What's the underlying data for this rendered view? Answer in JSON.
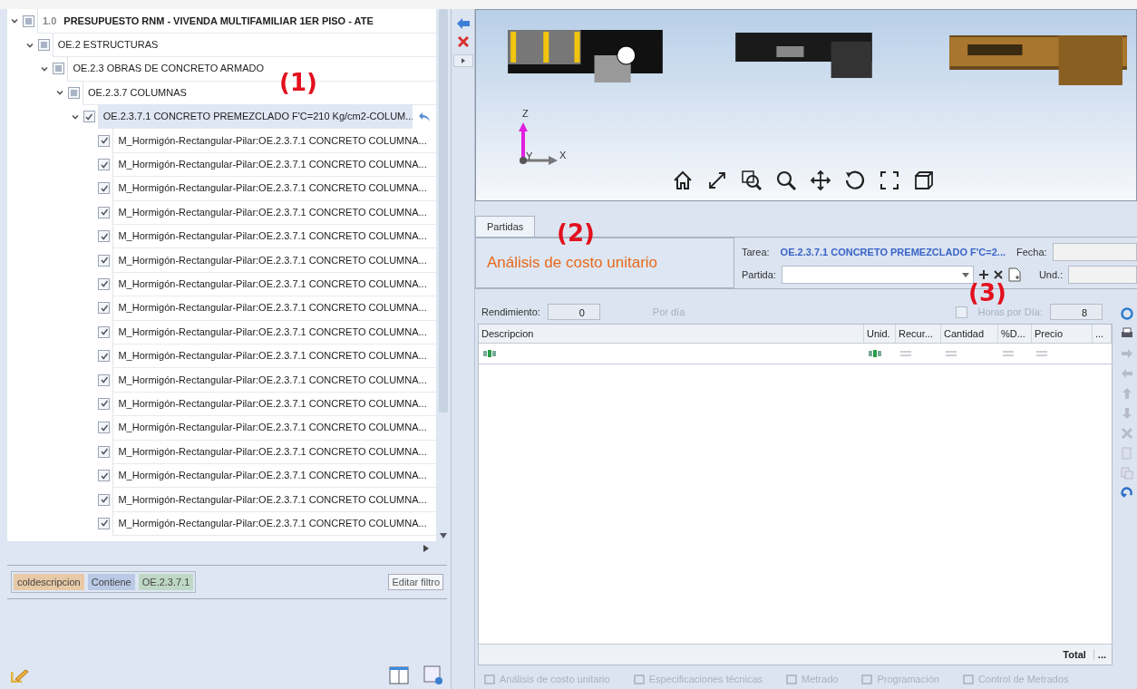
{
  "tree": [
    {
      "code": "1.0",
      "label": "PRESUPUESTO RNM - VIVENDA MULTIFAMILIAR 1ER PISO - ATE",
      "checked": false,
      "indeterminate": true,
      "selected": false,
      "expanded": true,
      "children": [
        {
          "label": "OE.2 ESTRUCTURAS",
          "checked": false,
          "indeterminate": true,
          "selected": false,
          "expanded": true,
          "children": [
            {
              "label": "OE.2.3 OBRAS DE CONCRETO ARMADO",
              "checked": false,
              "indeterminate": true,
              "selected": false,
              "expanded": true,
              "children": [
                {
                  "label": "OE.2.3.7 COLUMNAS",
                  "checked": false,
                  "indeterminate": true,
                  "selected": false,
                  "expanded": true,
                  "children": [
                    {
                      "label": "OE.2.3.7.1 CONCRETO PREMEZCLADO F'C=210 Kg/cm2-COLUM...",
                      "checked": true,
                      "selected": true,
                      "expanded": true,
                      "children": [
                        {
                          "label": "M_Hormigón-Rectangular-Pilar:OE.2.3.7.1 CONCRETO COLUMNA...",
                          "checked": true,
                          "indeterminate": false,
                          "selected": false
                        },
                        {
                          "label": "M_Hormigón-Rectangular-Pilar:OE.2.3.7.1 CONCRETO COLUMNA...",
                          "checked": true,
                          "indeterminate": false,
                          "selected": false
                        },
                        {
                          "label": "M_Hormigón-Rectangular-Pilar:OE.2.3.7.1 CONCRETO COLUMNA...",
                          "checked": true,
                          "indeterminate": false,
                          "selected": false
                        },
                        {
                          "label": "M_Hormigón-Rectangular-Pilar:OE.2.3.7.1 CONCRETO COLUMNA...",
                          "checked": true,
                          "indeterminate": false,
                          "selected": false
                        },
                        {
                          "label": "M_Hormigón-Rectangular-Pilar:OE.2.3.7.1 CONCRETO COLUMNA...",
                          "checked": true,
                          "indeterminate": false,
                          "selected": false
                        },
                        {
                          "label": "M_Hormigón-Rectangular-Pilar:OE.2.3.7.1 CONCRETO COLUMNA...",
                          "checked": true,
                          "indeterminate": false,
                          "selected": false
                        },
                        {
                          "label": "M_Hormigón-Rectangular-Pilar:OE.2.3.7.1 CONCRETO COLUMNA...",
                          "checked": true,
                          "indeterminate": false,
                          "selected": false
                        },
                        {
                          "label": "M_Hormigón-Rectangular-Pilar:OE.2.3.7.1 CONCRETO COLUMNA...",
                          "checked": true,
                          "indeterminate": false,
                          "selected": false
                        },
                        {
                          "label": "M_Hormigón-Rectangular-Pilar:OE.2.3.7.1 CONCRETO COLUMNA...",
                          "checked": true,
                          "indeterminate": false,
                          "selected": false
                        },
                        {
                          "label": "M_Hormigón-Rectangular-Pilar:OE.2.3.7.1 CONCRETO COLUMNA...",
                          "checked": true,
                          "indeterminate": false,
                          "selected": false
                        },
                        {
                          "label": "M_Hormigón-Rectangular-Pilar:OE.2.3.7.1 CONCRETO COLUMNA...",
                          "checked": true,
                          "indeterminate": false,
                          "selected": false
                        },
                        {
                          "label": "M_Hormigón-Rectangular-Pilar:OE.2.3.7.1 CONCRETO COLUMNA...",
                          "checked": true,
                          "indeterminate": false,
                          "selected": false
                        },
                        {
                          "label": "M_Hormigón-Rectangular-Pilar:OE.2.3.7.1 CONCRETO COLUMNA...",
                          "checked": true,
                          "indeterminate": false,
                          "selected": false
                        },
                        {
                          "label": "M_Hormigón-Rectangular-Pilar:OE.2.3.7.1 CONCRETO COLUMNA...",
                          "checked": true,
                          "indeterminate": false,
                          "selected": false
                        },
                        {
                          "label": "M_Hormigón-Rectangular-Pilar:OE.2.3.7.1 CONCRETO COLUMNA...",
                          "checked": true,
                          "indeterminate": false,
                          "selected": false
                        },
                        {
                          "label": "M_Hormigón-Rectangular-Pilar:OE.2.3.7.1 CONCRETO COLUMNA...",
                          "checked": true,
                          "indeterminate": false,
                          "selected": false
                        },
                        {
                          "label": "M_Hormigón-Rectangular-Pilar:OE.2.3.7.1 CONCRETO COLUMNA...",
                          "checked": true,
                          "indeterminate": false,
                          "selected": false
                        }
                      ]
                    }
                  ]
                }
              ]
            }
          ]
        }
      ]
    }
  ],
  "filter": {
    "chips": [
      {
        "text": "coldescripcion",
        "color": "#e8c9a6"
      },
      {
        "text": "Contiene",
        "color": "#b9c9e6"
      },
      {
        "text": "OE.2.3.7.1",
        "color": "#bfd8c6"
      }
    ],
    "edit_button": "Editar filtro"
  },
  "viewer": {
    "kind": "picture",
    "axes": [
      "Z",
      "Y",
      "X"
    ]
  },
  "tabs": [
    {
      "label": "Partidas",
      "selected": true
    }
  ],
  "header": {
    "title": "Análisis de costo unitario",
    "tarea_label": "Tarea:",
    "tarea_value": "OE.2.3.7.1 CONCRETO PREMEZCLADO F'C=2...",
    "fecha_label": "Fecha:",
    "partida_label": "Partida:",
    "und_label": "Und.:"
  },
  "rendimiento": {
    "label": "Rendimiento:",
    "value": "0",
    "unit": "Por día",
    "hours_label": "Horas por Día:",
    "hours_checked": false,
    "hours_value": "8"
  },
  "grid": {
    "columns": [
      {
        "label": "Descripcion",
        "kind": "text"
      },
      {
        "label": "Unid.",
        "kind": "text"
      },
      {
        "label": "Recur...",
        "kind": "number"
      },
      {
        "label": "Cantidad",
        "kind": "number"
      },
      {
        "label": "%D...",
        "kind": "number"
      },
      {
        "label": "Precio",
        "kind": "number"
      },
      {
        "label": "...",
        "kind": "more"
      }
    ],
    "total_label": "Total",
    "total_more": "..."
  },
  "bottom_tabs": [
    {
      "label": "Análisis de costo unitario",
      "disabled": true
    },
    {
      "label": "Especificaciones técnicas",
      "disabled": true
    },
    {
      "label": "Metrado",
      "disabled": true
    },
    {
      "label": "Programación",
      "disabled": true
    },
    {
      "label": "Control de Metrados",
      "disabled": true
    }
  ],
  "annotations": [
    {
      "text": "(1)"
    },
    {
      "text": "(2)"
    },
    {
      "text": "(3)"
    }
  ]
}
